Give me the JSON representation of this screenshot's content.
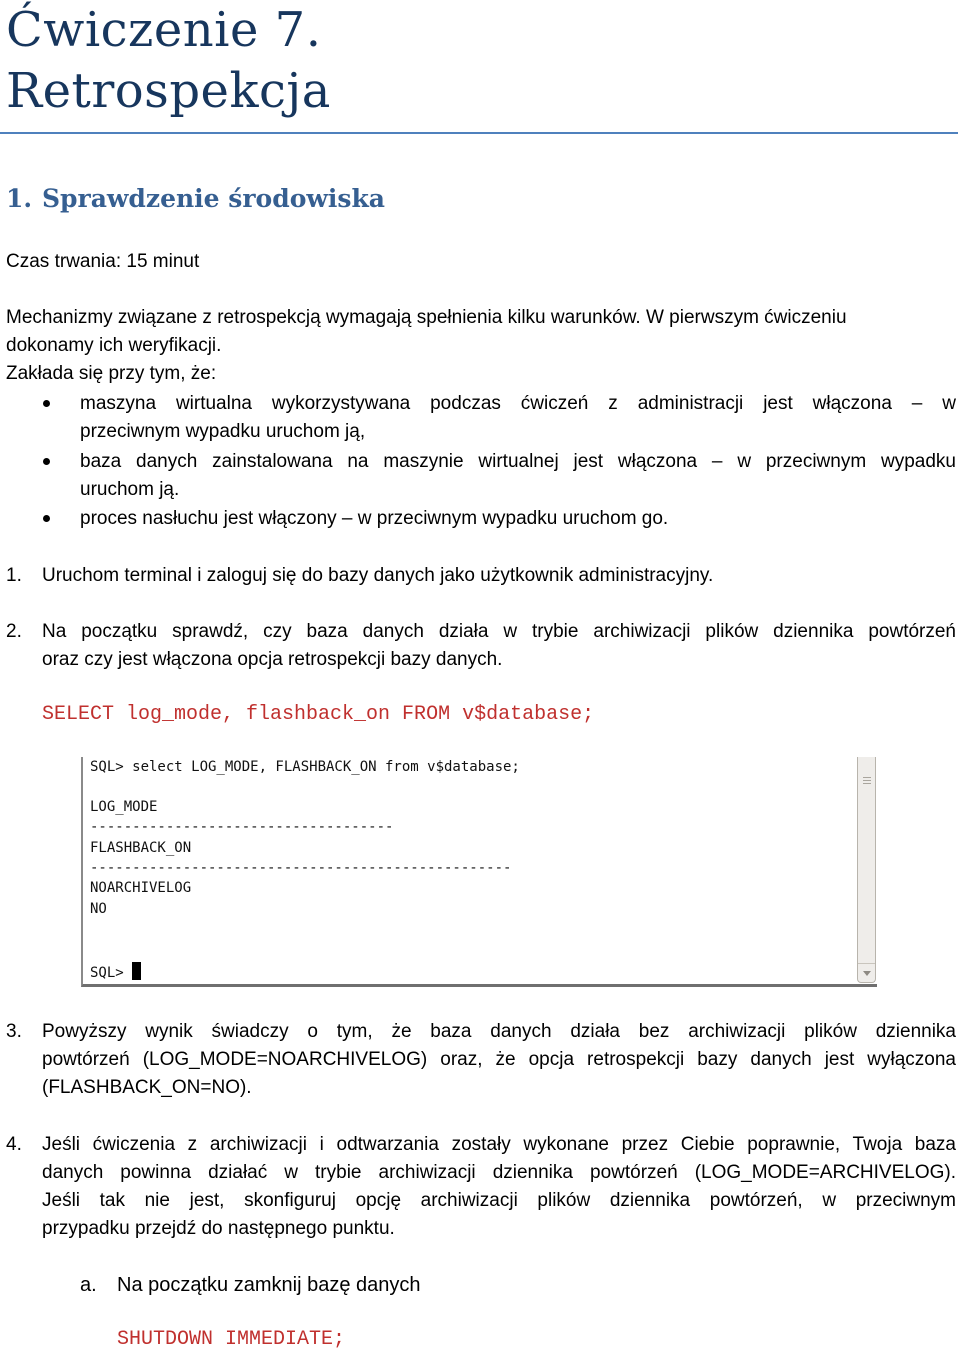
{
  "title": {
    "line1": "Ćwiczenie 7.",
    "line2": "Retrospekcja"
  },
  "section": {
    "number": "1.",
    "heading": "Sprawdzenie środowiska"
  },
  "duration": "Czas trwania: 15 minut",
  "intro": {
    "line1": "Mechanizmy związane z retrospekcją wymagają spełnienia kilku warunków. W pierwszym ćwiczeniu",
    "line2": "dokonamy ich weryfikacji.",
    "line3": "Zakłada się przy tym, że:"
  },
  "bullets": [
    {
      "line1": "maszyna wirtualna wykorzystywana podczas ćwiczeń z administracji jest włączona – w",
      "line2": "przeciwnym wypadku uruchom ją,"
    },
    {
      "line1": "baza danych zainstalowana na maszynie wirtualnej jest włączona – w przeciwnym wypadku",
      "line2": "uruchom ją."
    },
    {
      "line1": "proces nasłuchu jest włączony – w przeciwnym wypadku uruchom go.",
      "line2": ""
    }
  ],
  "steps": [
    {
      "number": "1.",
      "lines": [
        "Uruchom terminal i zaloguj się do bazy danych jako użytkownik administracyjny."
      ]
    },
    {
      "number": "2.",
      "lines": [
        "Na początku sprawdź, czy baza danych działa w trybie archiwizacji plików dziennika powtórzeń",
        "oraz czy jest włączona opcja retrospekcji bazy danych."
      ]
    },
    {
      "number": "3.",
      "lines": [
        "Powyższy wynik świadczy o tym, że baza danych działa bez archiwizacji plików dziennika",
        "powtórzeń (LOG_MODE=NOARCHIVELOG) oraz, że opcja retrospekcji bazy danych jest wyłączona",
        "(FLASHBACK_ON=NO)."
      ]
    },
    {
      "number": "4.",
      "lines": [
        "Jeśli ćwiczenia z archiwizacji i odtwarzania zostały wykonane przez Ciebie poprawnie, Twoja baza",
        "danych powinna działać w trybie archiwizacji dziennika powtórzeń (LOG_MODE=ARCHIVELOG).",
        "Jeśli tak nie jest, skonfiguruj opcję archiwizacji plików dziennika powtórzeń, w przeciwnym",
        "przypadku przejdź do następnego punktu."
      ]
    }
  ],
  "code1": "SELECT log_mode, flashback_on FROM v$database;",
  "terminal": {
    "lines": [
      "SQL> select LOG_MODE, FLASHBACK_ON from v$database;",
      "LOG_MODE",
      "------------------------------------",
      "FLASHBACK_ON",
      "--------------------------------------------------",
      "NOARCHIVELOG",
      "NO",
      "SQL> "
    ]
  },
  "substep": {
    "letter": "a.",
    "text": "Na początku zamknij bazę danych"
  },
  "code2": "SHUTDOWN IMMEDIATE;"
}
